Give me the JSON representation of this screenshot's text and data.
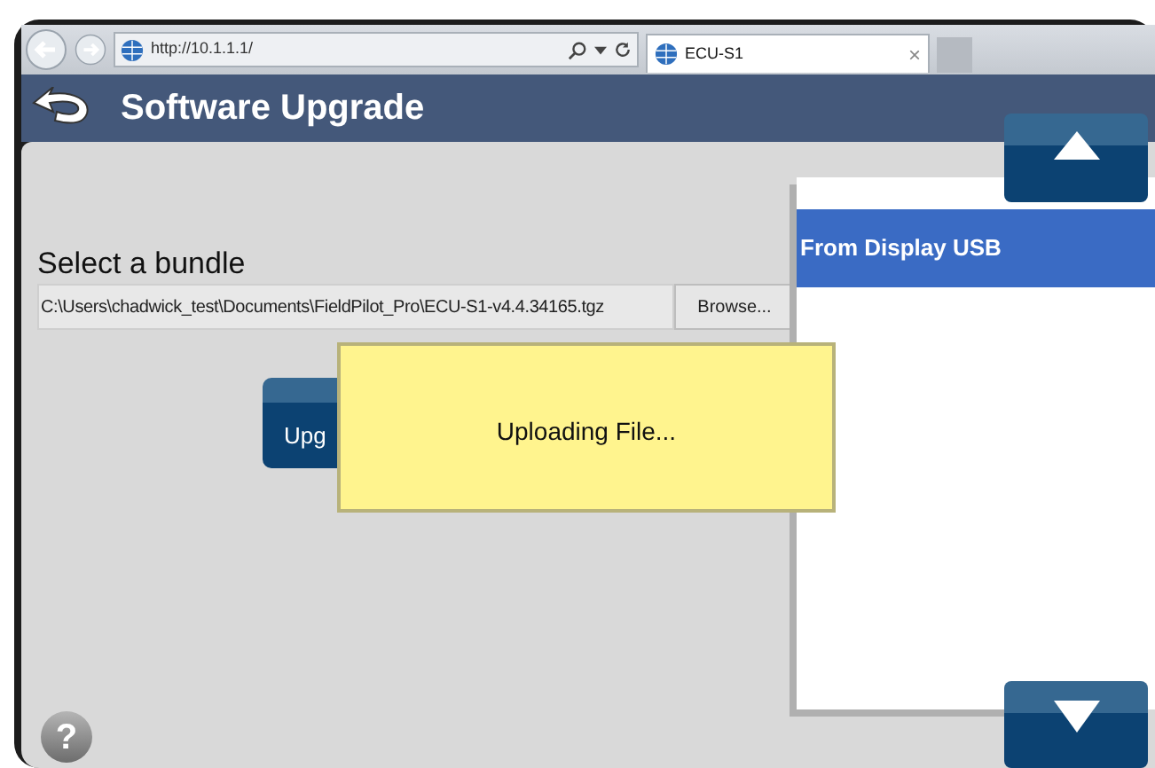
{
  "browser": {
    "address": "http://10.1.1.1/",
    "tab_title": "ECU-S1",
    "tab_close": "×"
  },
  "header": {
    "title": "Software Upgrade"
  },
  "form": {
    "label": "Select a bundle",
    "file_path": "C:\\Users\\chadwick_test\\Documents\\FieldPilot_Pro\\ECU-S1-v4.4.34165.tgz",
    "browse_button": "Browse...",
    "upgrade_button": "Upg"
  },
  "dialog": {
    "message": "Uploading File..."
  },
  "source_list": {
    "items": [
      {
        "label": "From Display USB",
        "selected": true
      }
    ]
  },
  "help": {
    "label": "?"
  }
}
